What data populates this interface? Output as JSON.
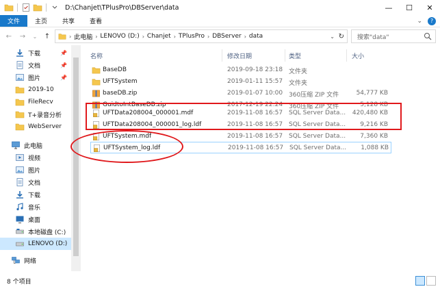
{
  "window": {
    "title": "D:\\Chanjet\\TPlusPro\\DBServer\\data",
    "minimize": "—",
    "maximize": "☐",
    "close": "✕"
  },
  "ribbon": {
    "tabs": [
      {
        "label": "文件",
        "active": true
      },
      {
        "label": "主页",
        "active": false
      },
      {
        "label": "共享",
        "active": false
      },
      {
        "label": "查看",
        "active": false
      }
    ],
    "expand": "⌄",
    "help": "?"
  },
  "nav": {
    "back": "←",
    "forward": "→",
    "recent": "⌄",
    "up": "↑",
    "crumbs": [
      "此电脑",
      "LENOVO (D:)",
      "Chanjet",
      "TPlusPro",
      "DBServer",
      "data"
    ],
    "dropdown": "⌄",
    "refresh": "↻"
  },
  "search": {
    "placeholder": "搜索\"data\""
  },
  "sidebar": {
    "items": [
      {
        "label": "下载",
        "icon": "download-icon",
        "pinned": true
      },
      {
        "label": "文档",
        "icon": "document-icon",
        "pinned": true
      },
      {
        "label": "图片",
        "icon": "picture-icon",
        "pinned": true
      },
      {
        "label": "2019-10",
        "icon": "folder-icon",
        "pinned": false
      },
      {
        "label": "FileRecv",
        "icon": "folder-icon",
        "pinned": false
      },
      {
        "label": "T+录音分析",
        "icon": "folder-icon",
        "pinned": false
      },
      {
        "label": "WebServer",
        "icon": "folder-icon",
        "pinned": false
      },
      {
        "label": "此电脑",
        "icon": "computer-icon",
        "pinned": false
      },
      {
        "label": "视频",
        "icon": "video-icon",
        "pinned": false
      },
      {
        "label": "图片",
        "icon": "picture-icon",
        "pinned": false
      },
      {
        "label": "文档",
        "icon": "document-icon",
        "pinned": false
      },
      {
        "label": "下载",
        "icon": "download-icon",
        "pinned": false
      },
      {
        "label": "音乐",
        "icon": "music-icon",
        "pinned": false
      },
      {
        "label": "桌面",
        "icon": "desktop-icon",
        "pinned": false
      },
      {
        "label": "本地磁盘 (C:)",
        "icon": "drive-icon",
        "pinned": false
      },
      {
        "label": "LENOVO (D:)",
        "icon": "drive-icon",
        "pinned": false,
        "selected": true
      },
      {
        "label": "网络",
        "icon": "network-icon",
        "pinned": false
      }
    ]
  },
  "columns": {
    "name": "名称",
    "date": "修改日期",
    "type": "类型",
    "size": "大小"
  },
  "files": [
    {
      "name": "BaseDB",
      "date": "2019-09-18 23:18",
      "type": "文件夹",
      "size": "",
      "icon": "folder-icon"
    },
    {
      "name": "UFTSystem",
      "date": "2019-01-11 15:57",
      "type": "文件夹",
      "size": "",
      "icon": "folder-icon"
    },
    {
      "name": "baseDB.zip",
      "date": "2019-01-07 10:00",
      "type": "360压缩 ZIP 文件",
      "size": "54,777 KB",
      "icon": "zip-icon"
    },
    {
      "name": "GuidtoIntBaseDB.zip",
      "date": "2017-12-19 22:24",
      "type": "360压缩 ZIP 文件",
      "size": "5,128 KB",
      "icon": "zip-icon"
    },
    {
      "name": "UFTData208004_000001.mdf",
      "date": "2019-11-08 16:57",
      "type": "SQL Server Data...",
      "size": "420,480 KB",
      "icon": "sql-data-icon"
    },
    {
      "name": "UFTData208004_000001_log.ldf",
      "date": "2019-11-08 16:57",
      "type": "SQL Server Data...",
      "size": "9,216 KB",
      "icon": "sql-data-icon"
    },
    {
      "name": "UFTSystem.mdf",
      "date": "2019-11-08 16:57",
      "type": "SQL Server Data...",
      "size": "7,360 KB",
      "icon": "sql-data-icon"
    },
    {
      "name": "UFTSystem_log.ldf",
      "date": "2019-11-08 16:57",
      "type": "SQL Server Data...",
      "size": "1,088 KB",
      "icon": "sql-data-icon"
    }
  ],
  "status": {
    "count": "8 个项目"
  },
  "colors": {
    "accent": "#1979ca",
    "selection": "#cce8ff",
    "annotation": "#e0181b",
    "folder": "#f5c74e"
  }
}
